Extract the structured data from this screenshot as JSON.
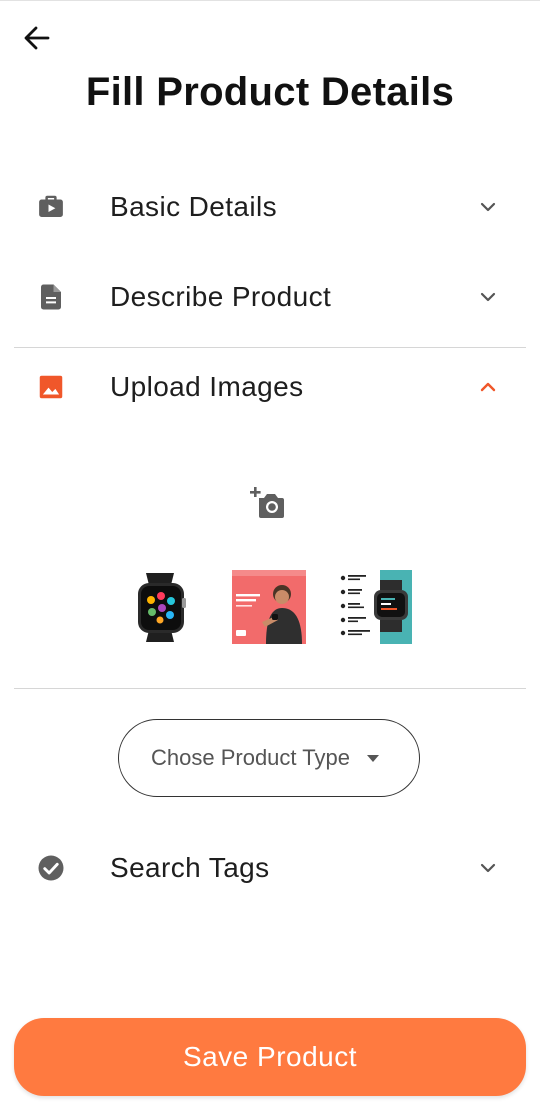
{
  "header": {
    "back_icon": "arrow-left-icon",
    "title": "Fill Product Details"
  },
  "sections": {
    "basic": {
      "label": "Basic Details",
      "icon": "briefcase-play-icon",
      "expanded": false
    },
    "describe": {
      "label": "Describe Product",
      "icon": "document-icon",
      "expanded": false
    },
    "upload": {
      "label": "Upload Images",
      "icon": "image-icon",
      "expanded": true
    },
    "tags": {
      "label": "Search Tags",
      "icon": "check-circle-icon",
      "expanded": false
    }
  },
  "upload": {
    "add_photo_icon": "add-photo-camera-icon",
    "images": [
      {
        "alt": "smartwatch product image"
      },
      {
        "alt": "smartwatch promotional banner with model"
      },
      {
        "alt": "smartwatch feature list image"
      }
    ],
    "thumb3_features": [
      "Full Touch Control",
      "10 Day Battery",
      "IP68 Waterproof",
      "Multi-Sports Mode",
      "Complete Health Tracking"
    ]
  },
  "product_type": {
    "placeholder": "Chose Product Type",
    "icon": "dropdown-caret-icon"
  },
  "actions": {
    "save_label": "Save Product"
  },
  "colors": {
    "accent": "#ff7a40",
    "active_icon": "#f0572a",
    "inactive_icon": "#5f5f5f",
    "text": "#1e1e1e"
  }
}
